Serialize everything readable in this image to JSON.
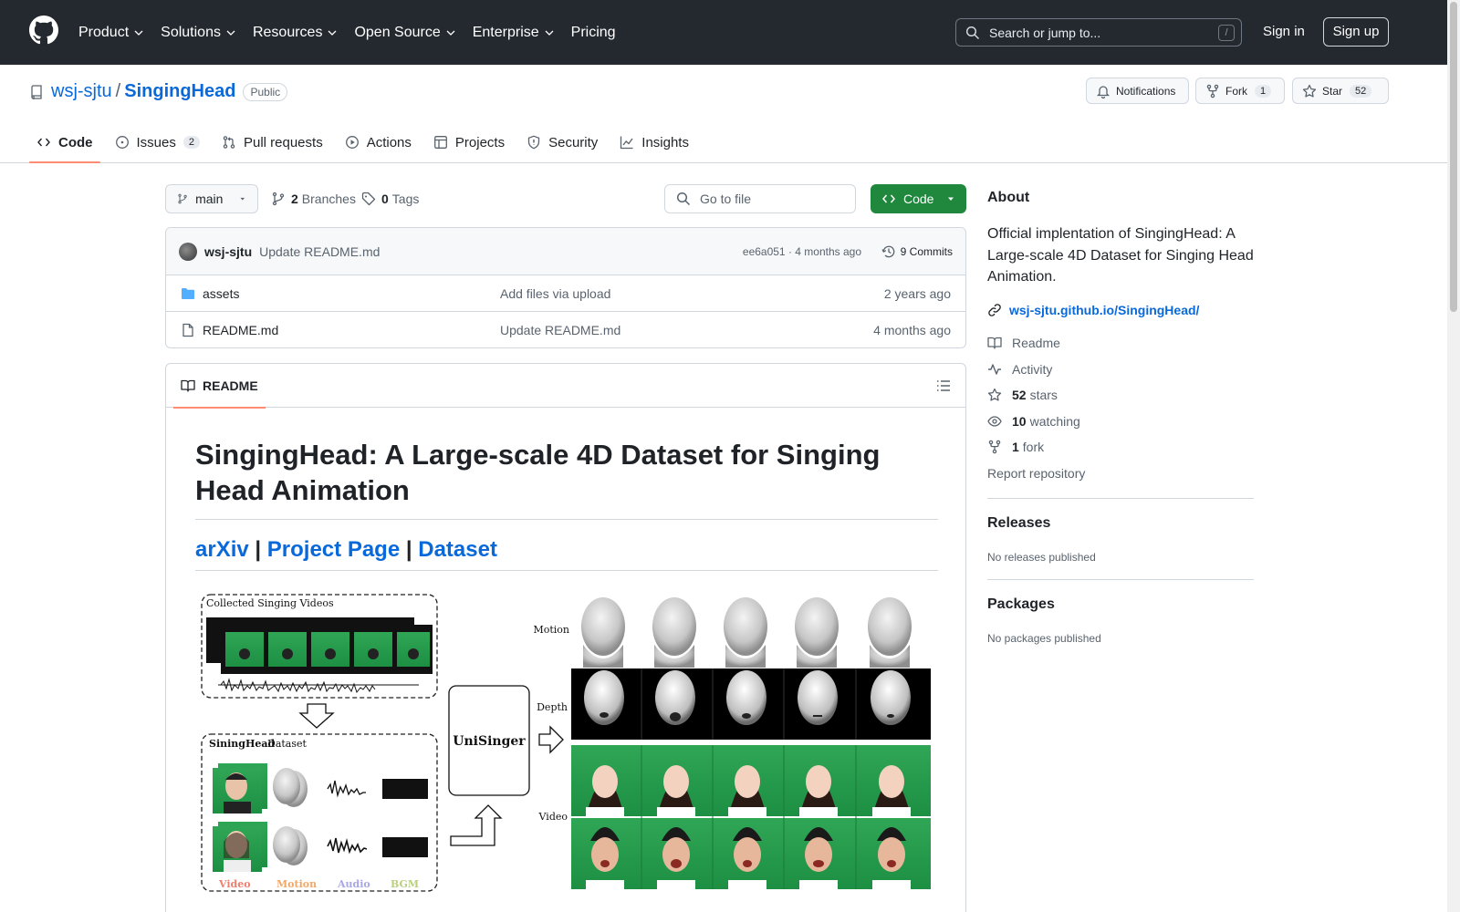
{
  "header": {
    "nav": [
      "Product",
      "Solutions",
      "Resources",
      "Open Source",
      "Enterprise",
      "Pricing"
    ],
    "search_placeholder": "Search or jump to...",
    "search_key": "/",
    "sign_in": "Sign in",
    "sign_up": "Sign up"
  },
  "repo": {
    "owner": "wsj-sjtu",
    "sep": "/",
    "name": "SingingHead",
    "visibility": "Public",
    "notifications": "Notifications",
    "fork_label": "Fork",
    "fork_count": "1",
    "star_label": "Star",
    "star_count": "52",
    "tabs": [
      {
        "label": "Code",
        "count": ""
      },
      {
        "label": "Issues",
        "count": "2"
      },
      {
        "label": "Pull requests",
        "count": ""
      },
      {
        "label": "Actions",
        "count": ""
      },
      {
        "label": "Projects",
        "count": ""
      },
      {
        "label": "Security",
        "count": ""
      },
      {
        "label": "Insights",
        "count": ""
      }
    ]
  },
  "toolbar": {
    "branch": "main",
    "branches_count": "2",
    "branches_label": "Branches",
    "tags_count": "0",
    "tags_label": "Tags",
    "go_to_file": "Go to file",
    "code_label": "Code"
  },
  "commit": {
    "author": "wsj-sjtu",
    "message": "Update README.md",
    "hash_time": "ee6a051 · 4 months ago",
    "commits": "9 Commits"
  },
  "files": [
    {
      "name": "assets",
      "type": "dir",
      "message": "Add files via upload",
      "age": "2 years ago"
    },
    {
      "name": "README.md",
      "type": "file",
      "message": "Update README.md",
      "age": "4 months ago"
    }
  ],
  "readme": {
    "tab": "README",
    "title": "SingingHead: A Large-scale 4D Dataset for Singing Head Animation",
    "links": [
      "arXiv",
      "Project Page",
      "Dataset"
    ],
    "link_sep": "|",
    "figure": {
      "collected": "Collected Singing Videos",
      "dataset_a": "SiningHead",
      "dataset_b": " Dataset",
      "model": "UniSinger",
      "row_motion": "Motion",
      "row_depth": "Depth",
      "row_video": "Video",
      "leg_video": "Video",
      "leg_motion": "Motion",
      "leg_audio": "Audio",
      "leg_bgm": "BGM"
    }
  },
  "sidebar": {
    "about": "About",
    "description": "Official implentation of SingingHead: A Large-scale 4D Dataset for Singing Head Animation.",
    "website": "wsj-sjtu.github.io/SingingHead/",
    "readme": "Readme",
    "activity": "Activity",
    "stars_n": "52",
    "stars": "stars",
    "watching_n": "10",
    "watching": "watching",
    "fork_n": "1",
    "fork": "fork",
    "report": "Report repository",
    "releases": "Releases",
    "no_releases": "No releases published",
    "packages": "Packages",
    "no_packages": "No packages published"
  },
  "colors": {
    "header_bg": "#24292f",
    "link": "#0969da",
    "green": "#1f883d",
    "accent_tab": "#fd8c73"
  }
}
